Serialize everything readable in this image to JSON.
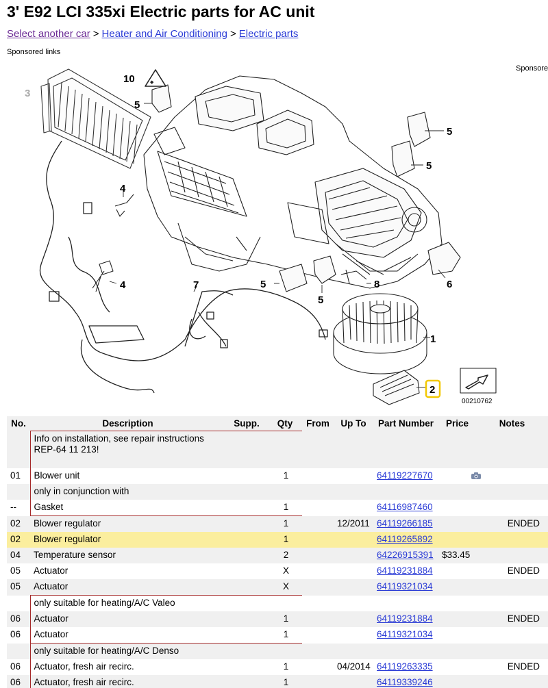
{
  "title": "3' E92 LCI 335xi Electric parts for AC unit",
  "breadcrumb": {
    "select_car": "Select another car",
    "sep1": ">",
    "heater": "Heater and Air Conditioning",
    "sep2": ">",
    "electric": "Electric parts"
  },
  "sponsored_left": "Sponsored links",
  "sponsored_right": "Sponsored",
  "diagram": {
    "callouts": [
      "1",
      "2",
      "3",
      "4",
      "4",
      "5",
      "5",
      "5",
      "5",
      "5",
      "5",
      "6",
      "7",
      "8",
      "10"
    ],
    "label_1": "1",
    "label_2": "2",
    "label_3": "3",
    "label_4a": "4",
    "label_4b": "4",
    "label_5a": "5",
    "label_5b": "5",
    "label_5c": "5",
    "label_5d": "5",
    "label_5e": "5",
    "label_6": "6",
    "label_7": "7",
    "label_8": "8",
    "label_10": "10",
    "diagram_number": "00210762"
  },
  "table": {
    "headers": {
      "no": "No.",
      "description": "Description",
      "supp": "Supp.",
      "qty": "Qty",
      "from": "From",
      "up_to": "Up To",
      "part_number": "Part Number",
      "price": "Price",
      "notes": "Notes"
    },
    "rows": [
      {
        "no": "",
        "description": "Info on installation, see repair instructions\nREP-64 11 213!",
        "qty": "",
        "up_to": "",
        "part": "",
        "price": "",
        "notes": ""
      },
      {
        "no": "01",
        "description": "Blower unit",
        "qty": "1",
        "up_to": "",
        "part": "64119227670",
        "price": "",
        "notes": ""
      },
      {
        "no": "",
        "description": "only in conjunction with",
        "qty": "",
        "up_to": "",
        "part": "",
        "price": "",
        "notes": ""
      },
      {
        "no": "--",
        "description": "Gasket",
        "qty": "1",
        "up_to": "",
        "part": "64116987460",
        "price": "",
        "notes": ""
      },
      {
        "no": "02",
        "description": "Blower regulator",
        "qty": "1",
        "up_to": "12/2011",
        "part": "64119266185",
        "price": "",
        "notes": "ENDED"
      },
      {
        "no": "02",
        "description": "Blower regulator",
        "qty": "1",
        "up_to": "",
        "part": "64119265892",
        "price": "",
        "notes": ""
      },
      {
        "no": "04",
        "description": "Temperature sensor",
        "qty": "2",
        "up_to": "",
        "part": "64226915391",
        "price": "$33.45",
        "notes": ""
      },
      {
        "no": "05",
        "description": "Actuator",
        "qty": "X",
        "up_to": "",
        "part": "64119231884",
        "price": "",
        "notes": "ENDED"
      },
      {
        "no": "05",
        "description": "Actuator",
        "qty": "X",
        "up_to": "",
        "part": "64119321034",
        "price": "",
        "notes": ""
      },
      {
        "no": "",
        "description": "only suitable for heating/A/C Valeo",
        "qty": "",
        "up_to": "",
        "part": "",
        "price": "",
        "notes": ""
      },
      {
        "no": "06",
        "description": "Actuator",
        "qty": "1",
        "up_to": "",
        "part": "64119231884",
        "price": "",
        "notes": "ENDED"
      },
      {
        "no": "06",
        "description": "Actuator",
        "qty": "1",
        "up_to": "",
        "part": "64119321034",
        "price": "",
        "notes": ""
      },
      {
        "no": "",
        "description": "only suitable for heating/A/C Denso",
        "qty": "",
        "up_to": "",
        "part": "",
        "price": "",
        "notes": ""
      },
      {
        "no": "06",
        "description": "Actuator, fresh air recirc.",
        "qty": "1",
        "up_to": "04/2014",
        "part": "64119263335",
        "price": "",
        "notes": "ENDED"
      },
      {
        "no": "06",
        "description": "Actuator, fresh air recirc.",
        "qty": "1",
        "up_to": "",
        "part": "64119339246",
        "price": "",
        "notes": ""
      }
    ]
  },
  "icons": {
    "camera": "camera-icon"
  },
  "colors": {
    "link": "#2a3bd6",
    "visited": "#6b2a94",
    "group_border": "#a52a2a",
    "highlight_row": "#fbee9e",
    "stripe": "#f0f0f0",
    "callout_highlight": "#f2c800"
  }
}
